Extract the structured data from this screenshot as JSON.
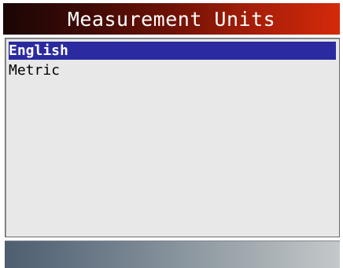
{
  "header": {
    "title": "Measurement Units"
  },
  "menu": {
    "items": [
      {
        "label": "English",
        "selected": true
      },
      {
        "label": "Metric",
        "selected": false
      }
    ]
  },
  "colors": {
    "selection_highlight": "#2b2aa0",
    "title_gradient_start": "#1a0606",
    "title_gradient_end": "#d42a0a",
    "list_background": "#e8e8e8"
  }
}
